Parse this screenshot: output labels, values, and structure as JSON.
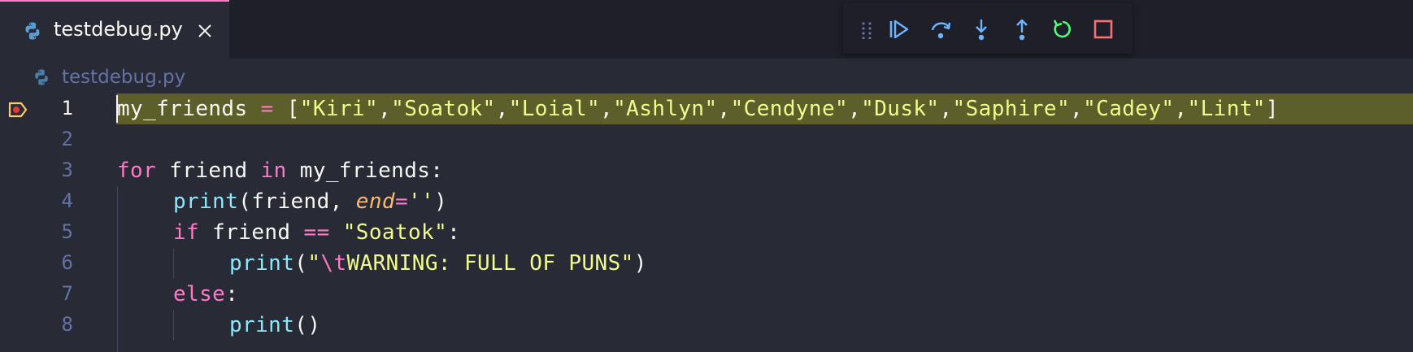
{
  "tab": {
    "label": "testdebug.py",
    "icon": "python-icon",
    "close_icon": "close-icon"
  },
  "debug_toolbar": {
    "buttons": [
      {
        "name": "continue",
        "icon": "continue-icon"
      },
      {
        "name": "step-over",
        "icon": "step-over-icon"
      },
      {
        "name": "step-into",
        "icon": "step-into-icon"
      },
      {
        "name": "step-out",
        "icon": "step-out-icon"
      },
      {
        "name": "restart",
        "icon": "restart-icon"
      },
      {
        "name": "stop",
        "icon": "stop-icon"
      }
    ]
  },
  "breadcrumb": {
    "label": "testdebug.py"
  },
  "editor": {
    "current_line": 1,
    "lines": [
      {
        "number": "1",
        "text": "my_friends = [\"Kiri\",\"Soatok\",\"Loial\",\"Ashlyn\",\"Cendyne\",\"Dusk\",\"Saphire\",\"Cadey\",\"Lint\"]"
      },
      {
        "number": "2",
        "text": ""
      },
      {
        "number": "3",
        "text": "for friend in my_friends:"
      },
      {
        "number": "4",
        "text": "    print(friend, end='')"
      },
      {
        "number": "5",
        "text": "    if friend == \"Soatok\":"
      },
      {
        "number": "6",
        "text": "        print(\"\\tWARNING: FULL OF PUNS\")"
      },
      {
        "number": "7",
        "text": "    else:"
      },
      {
        "number": "8",
        "text": "        print()"
      }
    ],
    "tokens": {
      "l1_var": "my_friends",
      "l1_eq": " = ",
      "l1_open": "[",
      "l1_items": [
        "\"Kiri\"",
        "\"Soatok\"",
        "\"Loial\"",
        "\"Ashlyn\"",
        "\"Cendyne\"",
        "\"Dusk\"",
        "\"Saphire\"",
        "\"Cadey\"",
        "\"Lint\""
      ],
      "l1_sep": ",",
      "l1_close": "]",
      "l3_for": "for",
      "l3_mid": " friend ",
      "l3_in": "in",
      "l3_end": " my_friends:",
      "l4_print": "print",
      "l4_args": "(friend, ",
      "l4_end_kw": "end",
      "l4_eq": "=",
      "l4_str": "''",
      "l4_close": ")",
      "l5_if": "if",
      "l5_mid": " friend ",
      "l5_op": "==",
      "l5_str": "\"Soatok\"",
      "l5_colon": ":",
      "l6_print": "print",
      "l6_open": "(",
      "l6_q1": "\"",
      "l6_esc": "\\t",
      "l6_str": "WARNING: FULL OF PUNS\"",
      "l6_close": ")",
      "l7_else": "else",
      "l7_colon": ":",
      "l8_print": "print",
      "l8_args": "()"
    }
  },
  "colors": {
    "background": "#282a36",
    "current_line": "#5c5f2a",
    "keyword": "#ff79c6",
    "function": "#8be9fd",
    "string": "#f1fa8c",
    "param": "#ffb86c",
    "comment_gray": "#6272a4",
    "continue": "#6cb6ff",
    "restart": "#50fa7b",
    "stop": "#ff6e6e"
  }
}
